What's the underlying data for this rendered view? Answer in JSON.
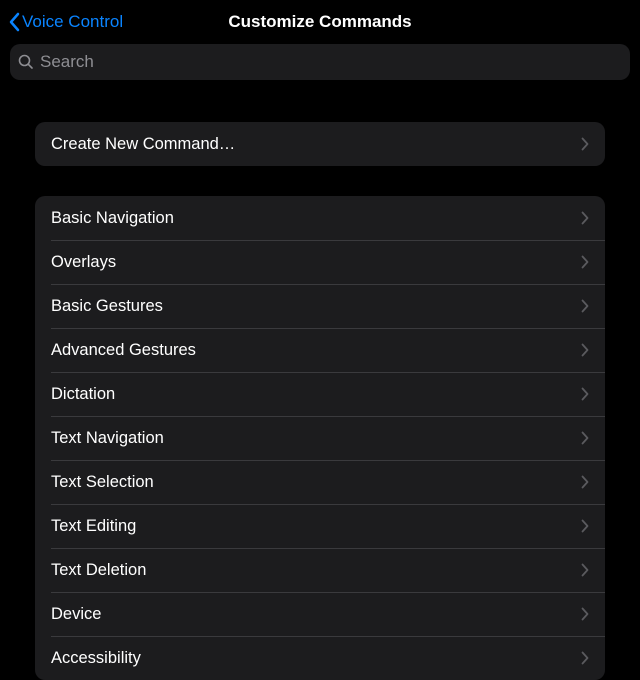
{
  "header": {
    "back_label": "Voice Control",
    "title": "Customize Commands"
  },
  "search": {
    "placeholder": "Search"
  },
  "top_action": {
    "label": "Create New Command…"
  },
  "categories": [
    {
      "label": "Basic Navigation"
    },
    {
      "label": "Overlays"
    },
    {
      "label": "Basic Gestures"
    },
    {
      "label": "Advanced Gestures"
    },
    {
      "label": "Dictation"
    },
    {
      "label": "Text Navigation"
    },
    {
      "label": "Text Selection"
    },
    {
      "label": "Text Editing"
    },
    {
      "label": "Text Deletion"
    },
    {
      "label": "Device"
    },
    {
      "label": "Accessibility"
    }
  ]
}
